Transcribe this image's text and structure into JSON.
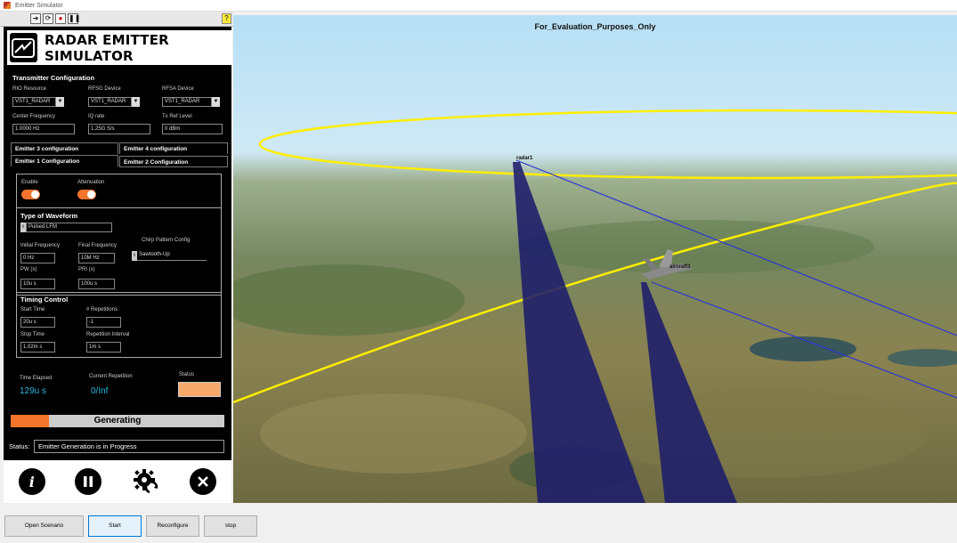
{
  "window": {
    "title": "Emitter Simulator"
  },
  "app": {
    "title": "RADAR EMITTER SIMULATOR"
  },
  "transmitter": {
    "header": "Transmitter Configuration",
    "rio_label": "RIO Resource",
    "rio_value": "VST1_RADAR",
    "rfsg_label": "RFSG Device",
    "rfsg_value": "VST1_RADAR",
    "rfsa_label": "RFSA Device",
    "rfsa_value": "VST1_RADAR",
    "cf_label": "Center Frequency",
    "cf_value": "1.0000 Hz",
    "iq_label": "IQ rate",
    "iq_value": "1.25G S/s",
    "tx_label": "Tx Ref Level",
    "tx_value": "0 dBm"
  },
  "tabs": [
    {
      "label": "Emitter 3 configuration"
    },
    {
      "label": "Emitter 4 configuration"
    },
    {
      "label": "Emitter 1 Configuration"
    },
    {
      "label": "Emitter 2 Configuration"
    }
  ],
  "emitter": {
    "enable_label": "Enable",
    "enable_on": true,
    "atten_label": "Attenuation",
    "atten_on": true,
    "waveform_header": "Type of Waveform",
    "waveform_value": "Pulsed LFM",
    "init_freq_label": "Initial Frequency",
    "init_freq_value": "0 Hz",
    "final_freq_label": "Final Frequency",
    "final_freq_value": "10M Hz",
    "chirp_label": "Chirp Pattern Config",
    "chirp_value": "Sawtooth-Up",
    "pw_label": "PW (s)",
    "pw_value": "10u s",
    "pri_label": "PRI (s)",
    "pri_value": "100u s",
    "timing_header": "Timing Control",
    "start_label": "Start Time",
    "start_value": "20u s",
    "reps_label": "# Repetitions",
    "reps_value": "-1",
    "stop_label": "Stop Time",
    "stop_value": "1.02m s",
    "interval_label": "Repetition Interval",
    "interval_value": "1m s"
  },
  "monitor": {
    "elapsed_label": "Time Elapsed",
    "elapsed_value": "129u s",
    "rep_label": "Current Repetition",
    "rep_value": "0/Inf",
    "status_label": "Status",
    "status_color": "#f7a86b"
  },
  "progress": {
    "label": "Generating",
    "fraction": 0.18
  },
  "status": {
    "label": "Status:",
    "value": "Emitter Generation is in Progress"
  },
  "icons": [
    "info-icon",
    "pause-icon",
    "settings-icon",
    "close-icon"
  ],
  "view": {
    "title": "For_Evaluation_Purposes_Only",
    "radar_label": "radar1",
    "aircraft_label": "aircraft1"
  },
  "buttons": {
    "open": "Open Scenario",
    "start": "Start",
    "reconfigure": "Reconfigure",
    "stop": "stop"
  },
  "colors": {
    "accent": "#f4742b",
    "value_blue": "#2bb6e0",
    "track": "#ffee00",
    "beam": "#1c1d6b"
  }
}
